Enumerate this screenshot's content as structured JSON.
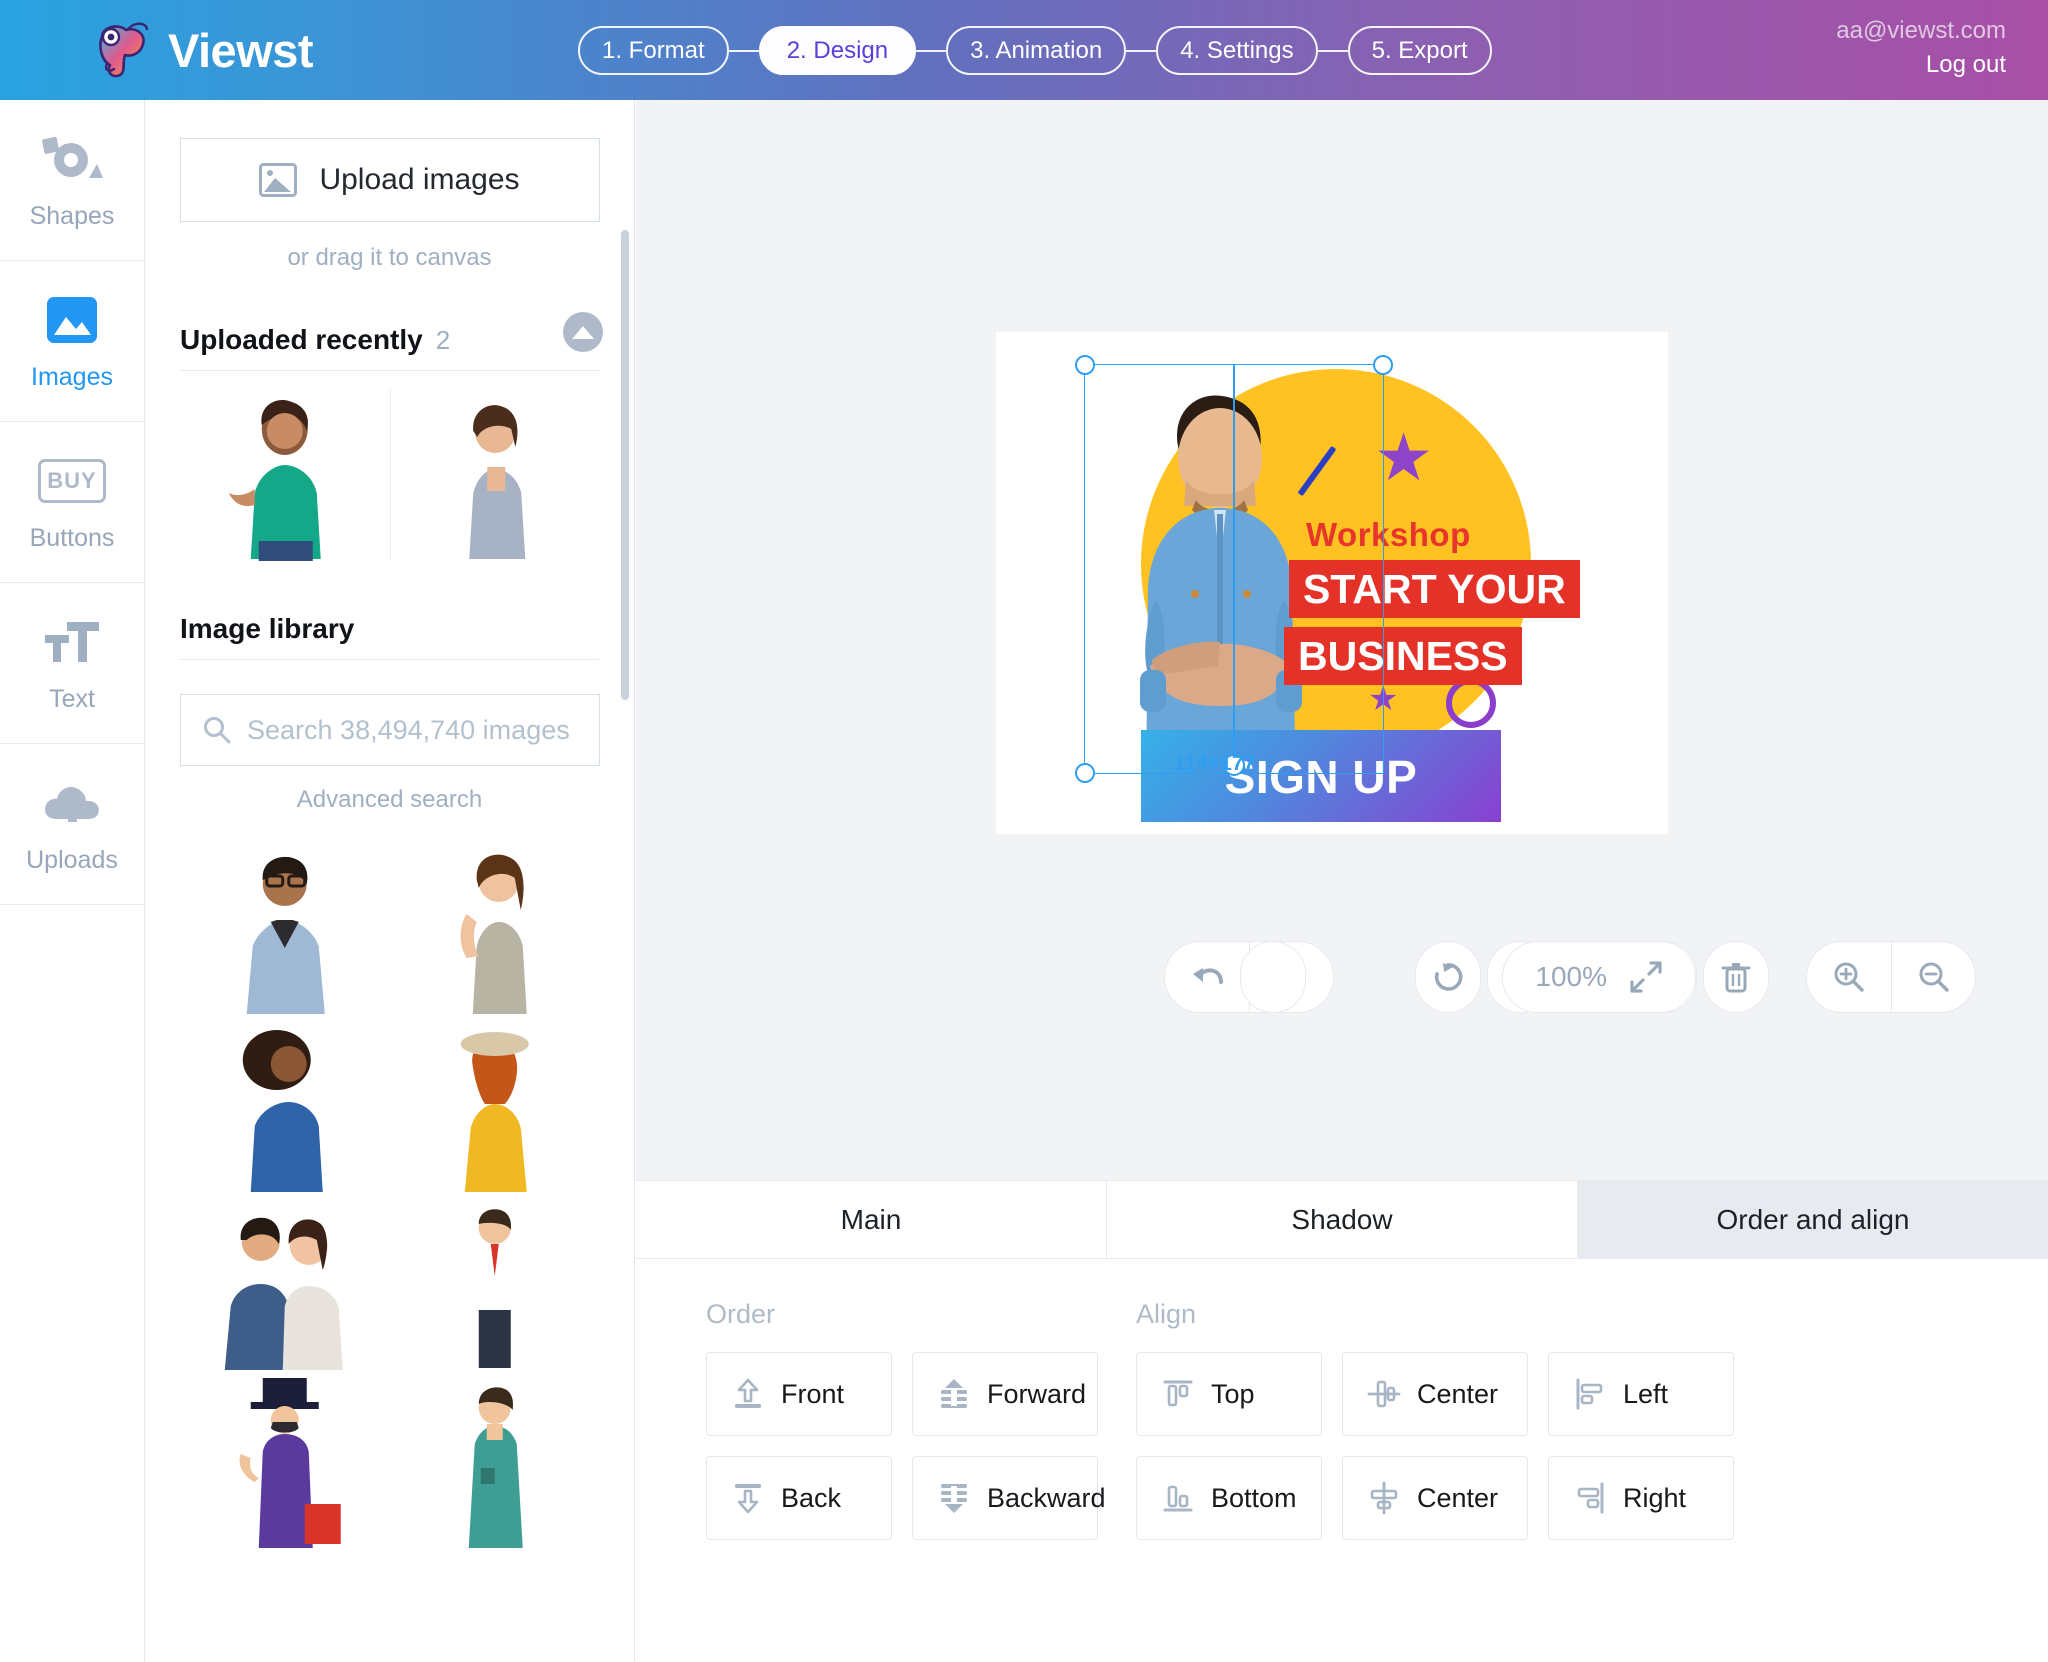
{
  "header": {
    "brand": "Viewst",
    "logo_icon": "chameleon-logo-icon",
    "steps": [
      {
        "label": "1. Format",
        "active": false
      },
      {
        "label": "2. Design",
        "active": true
      },
      {
        "label": "3. Animation",
        "active": false
      },
      {
        "label": "4. Settings",
        "active": false
      },
      {
        "label": "5. Export",
        "active": false
      }
    ],
    "account_email": "aa@viewst.com",
    "logout_label": "Log out",
    "gradient_from": "#29a3e0",
    "gradient_to": "#a84fa6"
  },
  "rail": {
    "items": [
      {
        "label": "Shapes",
        "icon": "shapes-icon",
        "active": false
      },
      {
        "label": "Images",
        "icon": "image-icon",
        "active": true
      },
      {
        "label": "Buttons",
        "icon": "buy-button-icon",
        "active": false
      },
      {
        "label": "Text",
        "icon": "text-icon",
        "active": false
      },
      {
        "label": "Uploads",
        "icon": "cloud-upload-icon",
        "active": false
      }
    ],
    "buttons_icon_label": "BUY",
    "active_color": "#2196f3",
    "inactive_color": "#97a6b8"
  },
  "panel": {
    "upload_button_label": "Upload images",
    "upload_button_icon": "image-placeholder-icon",
    "drag_hint": "or drag it to canvas",
    "recent": {
      "title": "Uploaded recently",
      "count": "2",
      "collapse_icon": "chevron-up-circle-icon",
      "thumbnails": [
        {
          "name": "woman-green-top-presenting"
        },
        {
          "name": "woman-grey-blazer-arms-crossed"
        }
      ]
    },
    "library": {
      "title": "Image library",
      "search_placeholder": "Search 38,494,740 images",
      "search_value": "",
      "search_icon": "search-icon",
      "advanced_search_label": "Advanced search",
      "thumbnails": [
        {
          "name": "man-glasses-denim-arms-crossed"
        },
        {
          "name": "woman-pointing-up-grey-sweater"
        },
        {
          "name": "woman-afro-blue-shirt"
        },
        {
          "name": "woman-hat-yellow-sweater"
        },
        {
          "name": "couple-plaid-embrace"
        },
        {
          "name": "illustration-man-red-tie"
        },
        {
          "name": "illustration-magician-top-hat"
        },
        {
          "name": "illustration-man-teal-shirt"
        }
      ]
    }
  },
  "canvas": {
    "banner": {
      "eyebrow": "Workshop",
      "headline_line1": "START YOUR",
      "headline_line2": "BUSINESS",
      "cta_label": "SIGN UP",
      "eyebrow_color": "#e8352b",
      "headline_bg": "#e53228",
      "circle_color": "#ffc222",
      "accent_purple": "#8b3ecc"
    },
    "selection": {
      "size_label": "114×177",
      "color": "#2f9ef0"
    },
    "toolbar": {
      "undo": "undo-icon",
      "redo": "redo-icon",
      "rotate": "rotate-icon",
      "flip_vertical": "flip-vertical-icon",
      "flip_horizontal": "flip-horizontal-icon",
      "duplicate": "duplicate-icon",
      "delete": "trash-icon",
      "zoom_value": "100%",
      "fit_icon": "fit-screen-icon",
      "zoom_in": "zoom-in-icon",
      "zoom_out": "zoom-out-icon"
    }
  },
  "properties": {
    "tabs": [
      {
        "label": "Main",
        "active": false
      },
      {
        "label": "Shadow",
        "active": false
      },
      {
        "label": "Order and align",
        "active": true
      }
    ],
    "order": {
      "title": "Order",
      "buttons": [
        {
          "label": "Front",
          "icon": "bring-to-front-icon"
        },
        {
          "label": "Forward",
          "icon": "bring-forward-icon"
        },
        {
          "label": "Back",
          "icon": "send-to-back-icon"
        },
        {
          "label": "Backward",
          "icon": "send-backward-icon"
        }
      ]
    },
    "align": {
      "title": "Align",
      "buttons": [
        {
          "label": "Top",
          "icon": "align-top-icon"
        },
        {
          "label": "Center",
          "icon": "align-center-horizontal-icon"
        },
        {
          "label": "Left",
          "icon": "align-left-icon"
        },
        {
          "label": "Bottom",
          "icon": "align-bottom-icon"
        },
        {
          "label": "Center",
          "icon": "align-center-vertical-icon"
        },
        {
          "label": "Right",
          "icon": "align-right-icon"
        }
      ]
    }
  }
}
